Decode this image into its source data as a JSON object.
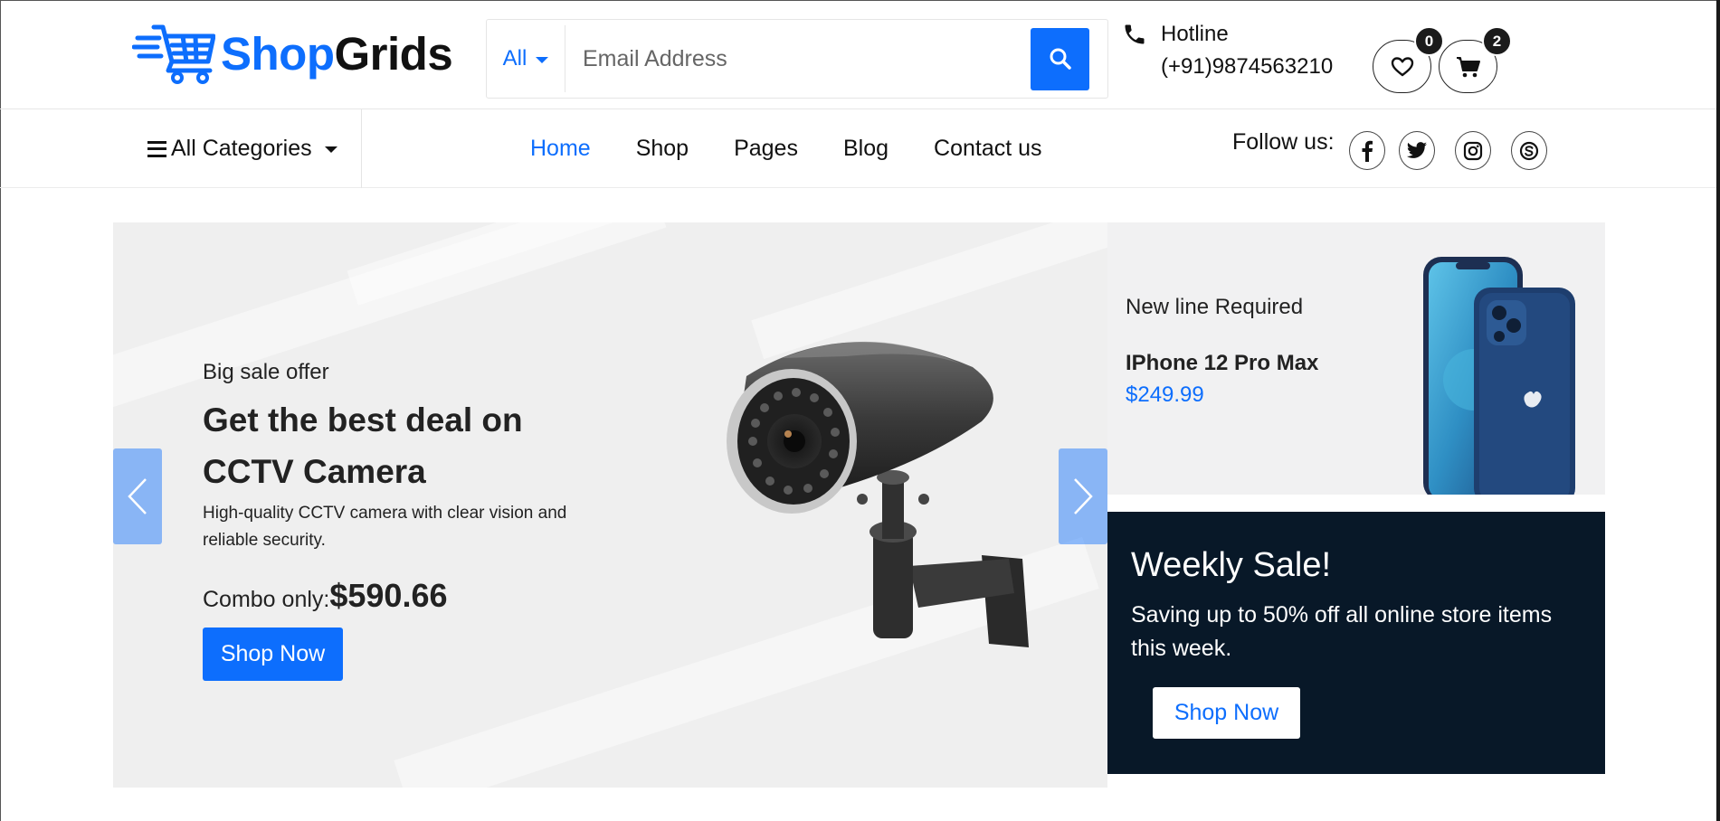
{
  "header": {
    "logo": {
      "brand_part1": "Shop",
      "brand_part2": "Grids"
    },
    "search": {
      "category": "All",
      "placeholder": "Email Address"
    },
    "hotline": {
      "label": "Hotline",
      "number": "(+91)9874563210"
    },
    "wishlist": {
      "count": "0"
    },
    "cart": {
      "count": "2"
    }
  },
  "nav": {
    "categories_label": "All Categories",
    "menu": [
      {
        "label": "Home",
        "active": true
      },
      {
        "label": "Shop",
        "active": false
      },
      {
        "label": "Pages",
        "active": false
      },
      {
        "label": "Blog",
        "active": false
      },
      {
        "label": "Contact us",
        "active": false
      }
    ],
    "follow_label": "Follow us:",
    "social": [
      "facebook-icon",
      "twitter-icon",
      "instagram-icon",
      "skype-icon"
    ]
  },
  "hero": {
    "small_title": "Big sale offer",
    "title": "Get the best deal on CCTV Camera",
    "description": "High-quality CCTV camera with clear vision and reliable security.",
    "combo_label": "Combo only:",
    "combo_price": "$590.66",
    "button": "Shop Now"
  },
  "promo": {
    "subtitle": "New line Required",
    "product": "IPhone 12 Pro Max",
    "price": "$249.99"
  },
  "weekly_sale": {
    "title": "Weekly Sale!",
    "text": "Saving up to 50% off all online store items this week.",
    "button": "Shop Now"
  },
  "colors": {
    "accent": "#0d6efd",
    "dark_banner": "#081828",
    "hero_bg": "#efefef"
  }
}
